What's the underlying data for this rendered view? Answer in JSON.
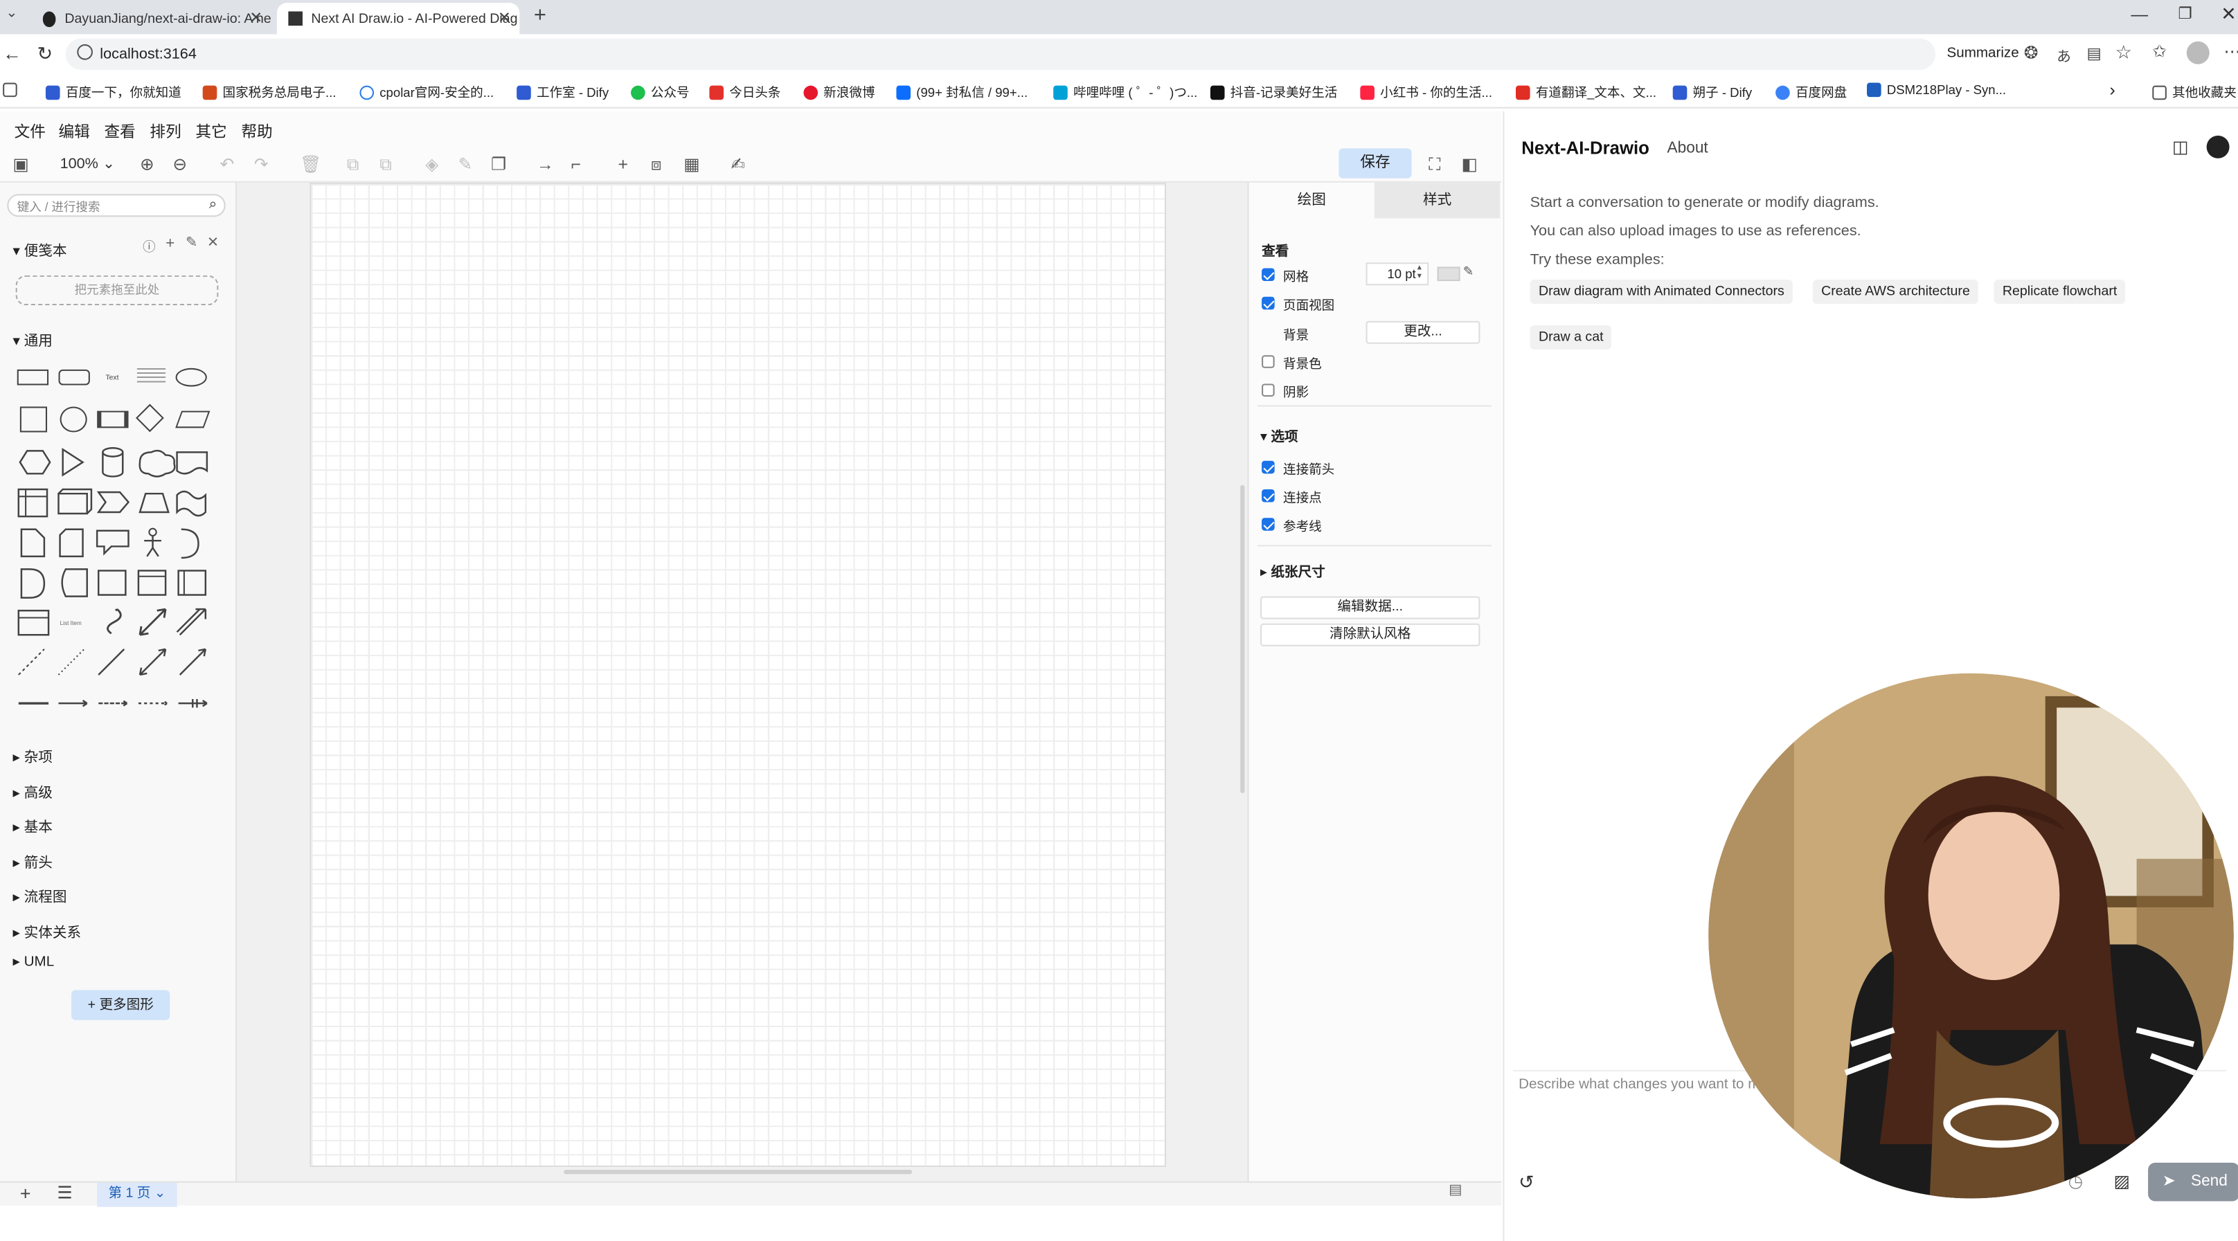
{
  "browser": {
    "tabs": [
      {
        "title": "DayuanJiang/next-ai-draw-io: A ne",
        "close": "✕"
      },
      {
        "title": "Next AI Draw.io - AI-Powered Diag",
        "close": "✕"
      }
    ],
    "url": "localhost:3164",
    "summarize": "Summarize",
    "bookmarks": [
      "百度一下，你就知道",
      "国家税务总局电子...",
      "cpolar官网-安全的...",
      "工作室 - Dify",
      "公众号",
      "今日头条",
      "新浪微博",
      "(99+ 封私信 / 99+...",
      "哔哩哔哩 ( ゜- ゜)つ...",
      "抖音-记录美好生活",
      "小红书 - 你的生活...",
      "有道翻译_文本、文...",
      "朔子 - Dify",
      "百度网盘",
      "DSM218Play - Syn..."
    ],
    "other_bookmarks": "其他收藏夹"
  },
  "drawio": {
    "menu": [
      "文件",
      "编辑",
      "查看",
      "排列",
      "其它",
      "帮助"
    ],
    "zoom": "100%",
    "save": "保存",
    "search_placeholder": "键入 / 进行搜索",
    "scratchpad": "便笺本",
    "drop_here": "把元素拖至此处",
    "general": "通用",
    "text_shape": "Text",
    "categories": [
      "杂项",
      "高级",
      "基本",
      "箭头",
      "流程图",
      "实体关系",
      "UML"
    ],
    "more_shapes": "+ 更多图形",
    "format": {
      "tab_draw": "绘图",
      "tab_style": "样式",
      "view": "查看",
      "grid": "网格",
      "grid_size": "10 pt",
      "page_view": "页面视图",
      "background": "背景",
      "change": "更改...",
      "bg_color": "背景色",
      "shadow": "阴影",
      "options": "选项",
      "connection_arrows": "连接箭头",
      "connection_points": "连接点",
      "guides": "参考线",
      "paper_size": "纸张尺寸",
      "edit_data": "编辑数据...",
      "clear_style": "清除默认风格"
    },
    "page_tab": "第 1 页"
  },
  "chat": {
    "title": "Next-AI-Drawio",
    "about": "About",
    "intro1": "Start a conversation to generate or modify diagrams.",
    "intro2": "You can also upload images to use as references.",
    "try": "Try these examples:",
    "examples": [
      "Draw diagram with Animated Connectors",
      "Create AWS architecture",
      "Replicate flowchart",
      "Draw a cat"
    ],
    "placeholder": "Describe what changes you want to make to the diagram. (Press Cmd/Ctrl + Enter to send)",
    "send": "Send"
  }
}
